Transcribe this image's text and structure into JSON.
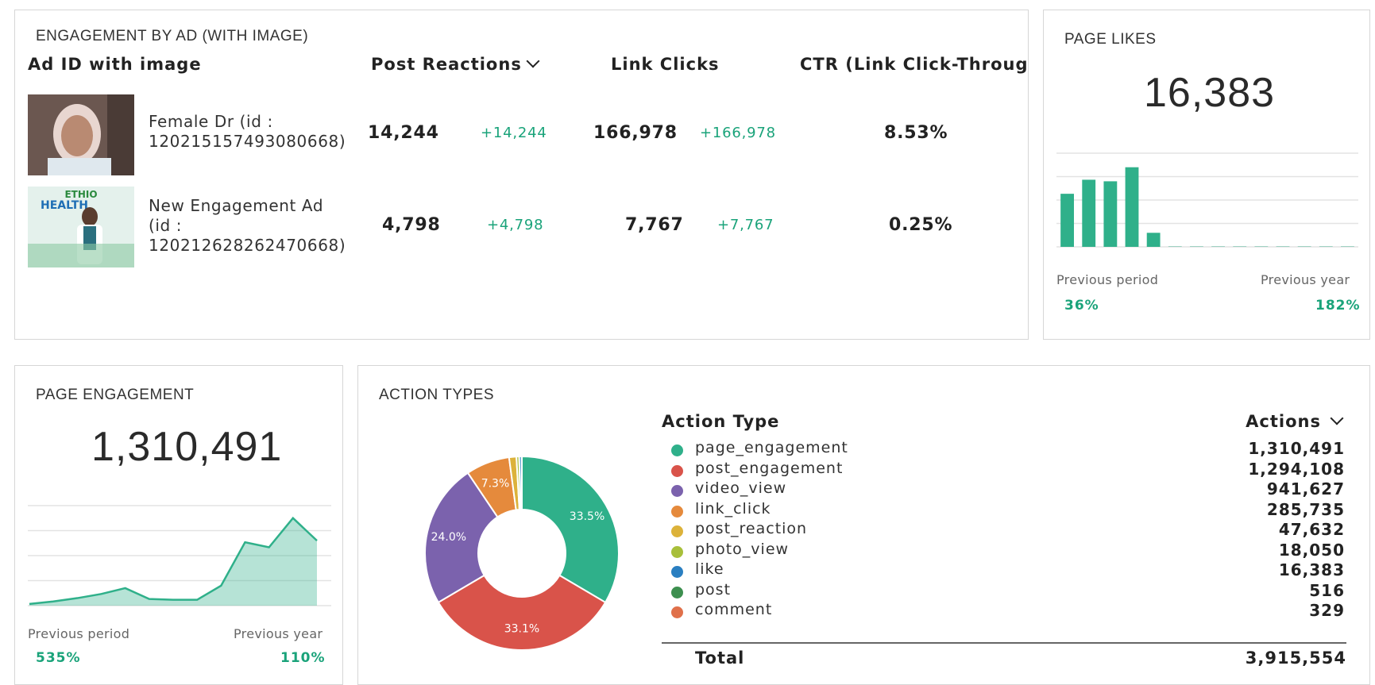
{
  "ads_card": {
    "title": "ENGAGEMENT BY AD (WITH IMAGE)",
    "columns": {
      "ad": "Ad ID with image",
      "reactions": "Post Reactions",
      "clicks": "Link Clicks",
      "ctr": "CTR (Link Click-Throug"
    },
    "rows": [
      {
        "name_line1": "Female Dr (id :",
        "name_line2": "120215157493080668)",
        "name_line3": "",
        "reactions": "14,244",
        "reactions_delta": "+14,244",
        "clicks": "166,978",
        "clicks_delta": "+166,978",
        "ctr": "8.53%"
      },
      {
        "name_line1": "New Engagement Ad",
        "name_line2": "(id :",
        "name_line3": "120212628262470668)",
        "reactions": "4,798",
        "reactions_delta": "+4,798",
        "clicks": "7,767",
        "clicks_delta": "+7,767",
        "ctr": "0.25%",
        "thumb_text_1": "ETHIO",
        "thumb_text_2": "HEALTH"
      }
    ]
  },
  "likes_card": {
    "title": "PAGE LIKES",
    "value": "16,383",
    "prev_period_label": "Previous period",
    "prev_period_value": "36%",
    "prev_year_label": "Previous year",
    "prev_year_value": "182%"
  },
  "engagement_card": {
    "title": "PAGE ENGAGEMENT",
    "value": "1,310,491",
    "prev_period_label": "Previous period",
    "prev_period_value": "535%",
    "prev_year_label": "Previous year",
    "prev_year_value": "110%"
  },
  "actions_card": {
    "title": "ACTION TYPES",
    "col_type": "Action Type",
    "col_actions": "Actions",
    "total_label": "Total",
    "total_value": "3,915,554"
  },
  "colors": {
    "accent_green": "#2fb08a",
    "delta_green": "#1aa37a"
  },
  "chart_data": [
    {
      "type": "bar",
      "chart": "page-likes-trend",
      "values": [
        34,
        43,
        42,
        51,
        9,
        0,
        0,
        0,
        0,
        0,
        0,
        0,
        0,
        0
      ],
      "grid": true
    },
    {
      "type": "area",
      "chart": "page-engagement-trend",
      "values": [
        2,
        5,
        9,
        14,
        21,
        8,
        7,
        7,
        24,
        76,
        70,
        105,
        78
      ],
      "grid": true
    },
    {
      "type": "pie",
      "chart": "action-types-donut",
      "slices": [
        {
          "label": "page_engagement",
          "value": 1310491,
          "pct_label": "33.5%",
          "color": "#2fb08a"
        },
        {
          "label": "post_engagement",
          "value": 1294108,
          "pct_label": "33.1%",
          "color": "#d9534a"
        },
        {
          "label": "video_view",
          "value": 941627,
          "pct_label": "24.0%",
          "color": "#7b62ad"
        },
        {
          "label": "link_click",
          "value": 285735,
          "pct_label": "7.3%",
          "color": "#e58a3c"
        },
        {
          "label": "post_reaction",
          "value": 47632,
          "pct_label": "",
          "color": "#dcb23a"
        },
        {
          "label": "photo_view",
          "value": 18050,
          "pct_label": "",
          "color": "#a8bf3a"
        },
        {
          "label": "like",
          "value": 16383,
          "pct_label": "",
          "color": "#2a7fc1"
        },
        {
          "label": "post",
          "value": 516,
          "pct_label": "",
          "color": "#3d8f4f"
        },
        {
          "label": "comment",
          "value": 329,
          "pct_label": "",
          "color": "#e0704a"
        }
      ]
    }
  ]
}
